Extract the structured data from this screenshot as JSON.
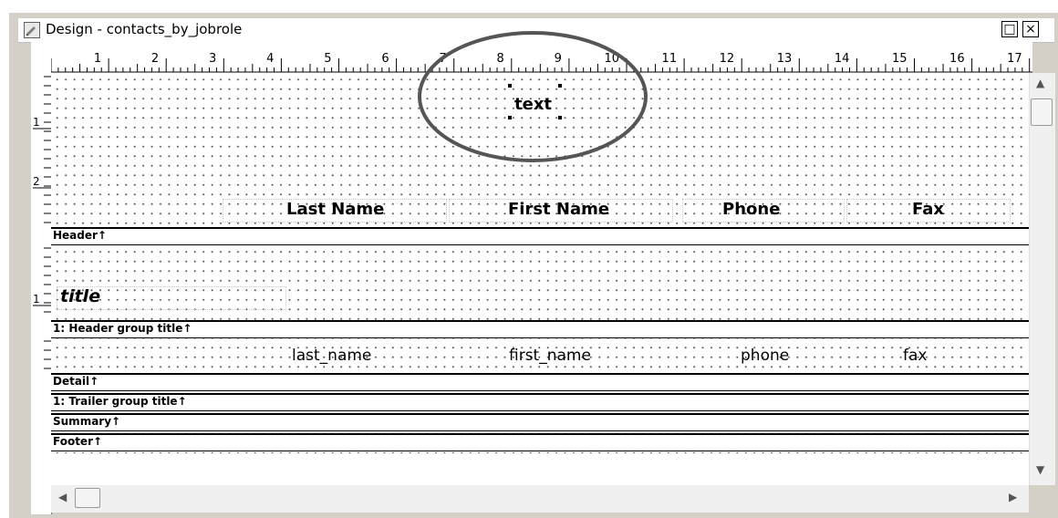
{
  "window": {
    "title": "Design - contacts_by_jobrole",
    "restore_glyph": "□",
    "close_glyph": "×"
  },
  "ruler": {
    "horizontal": [
      "1",
      "2",
      "3",
      "4",
      "5",
      "6",
      "7",
      "8",
      "9",
      "10",
      "11",
      "12",
      "13",
      "14",
      "15",
      "16",
      "17"
    ],
    "vertical": [
      "1",
      "2",
      "1"
    ]
  },
  "design": {
    "text_control": "text",
    "header_columns": [
      "Last Name",
      "First Name",
      "Phone",
      "Fax"
    ],
    "group_title_field": "title",
    "detail_fields": [
      "last_name",
      "first_name",
      "phone",
      "fax"
    ]
  },
  "bands": {
    "header": "Header↑",
    "header_group": "1: Header group title↑",
    "detail": "Detail↑",
    "trailer_group": "1: Trailer group title↑",
    "summary": "Summary↑",
    "footer": "Footer↑"
  },
  "icons": {
    "app": "design-window-icon",
    "scroll_up": "up-arrow-icon",
    "scroll_down": "down-arrow-icon",
    "scroll_left": "left-arrow-icon",
    "scroll_right": "right-arrow-icon"
  }
}
